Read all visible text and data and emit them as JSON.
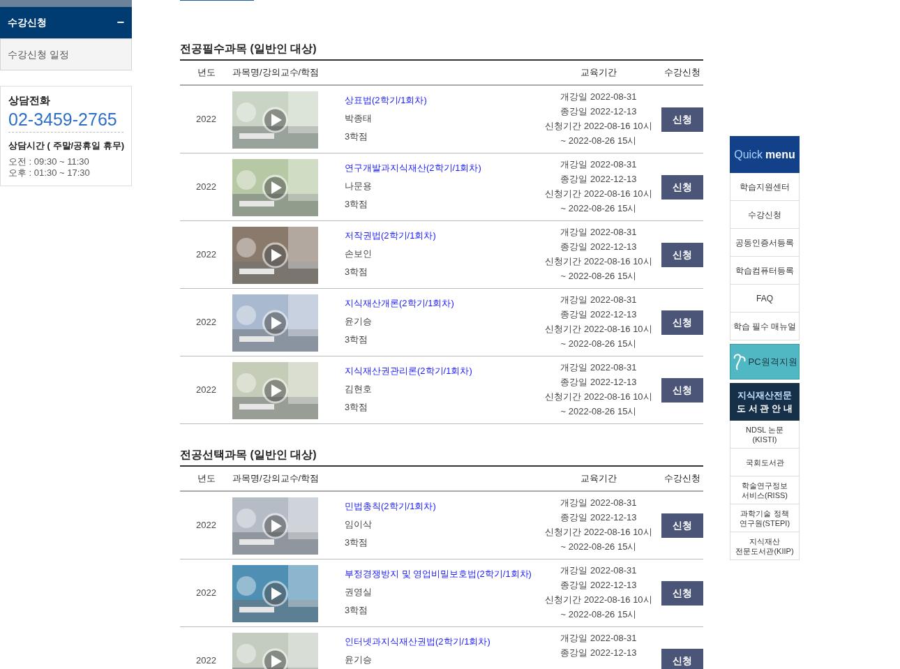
{
  "sidebar": {
    "menu_title": "수강신청",
    "toggle": "−",
    "items": [
      {
        "label": "수강신청 일정",
        "selected": false
      }
    ],
    "contact": {
      "title": "상담전화",
      "phone": "02-3459-2765",
      "hours_title": "상담시간 ( 주말/공휴일 휴무)",
      "hours": [
        "오전 : 09:30 ~ 11:30",
        "오후 : 01:30 ~ 17:30"
      ]
    }
  },
  "sections": [
    {
      "title": "전공필수과목 (일반인 대상)",
      "columns": [
        "년도",
        "과목명/강의교수/학점",
        "교육기간",
        "수강신청"
      ],
      "rows": [
        {
          "year": "2022",
          "course": "상표법(2학기/1회차)",
          "professor": "박종태",
          "credits": "3학점",
          "start": "개강일 2022-08-31",
          "end": "종강일 2022-12-13",
          "apply_start": "신청기간 2022-08-16 10시",
          "apply_end": "~ 2022-08-26 15시",
          "button": "신청"
        },
        {
          "year": "2022",
          "course": "연구개발과지식재산(2학기/1회차)",
          "professor": "나문용",
          "credits": "3학점",
          "start": "개강일 2022-08-31",
          "end": "종강일 2022-12-13",
          "apply_start": "신청기간 2022-08-16 10시",
          "apply_end": "~ 2022-08-26 15시",
          "button": "신청"
        },
        {
          "year": "2022",
          "course": "저작권법(2학기/1회차)",
          "professor": "손보인",
          "credits": "3학점",
          "start": "개강일 2022-08-31",
          "end": "종강일 2022-12-13",
          "apply_start": "신청기간 2022-08-16 10시",
          "apply_end": "~ 2022-08-26 15시",
          "button": "신청"
        },
        {
          "year": "2022",
          "course": "지식재산개론(2학기/1회차)",
          "professor": "윤기승",
          "credits": "3학점",
          "start": "개강일 2022-08-31",
          "end": "종강일 2022-12-13",
          "apply_start": "신청기간 2022-08-16 10시",
          "apply_end": "~ 2022-08-26 15시",
          "button": "신청"
        },
        {
          "year": "2022",
          "course": "지식재산권관리론(2학기/1회차)",
          "professor": "김현호",
          "credits": "3학점",
          "start": "개강일 2022-08-31",
          "end": "종강일 2022-12-13",
          "apply_start": "신청기간 2022-08-16 10시",
          "apply_end": "~ 2022-08-26 15시",
          "button": "신청"
        }
      ]
    },
    {
      "title": "전공선택과목 (일반인 대상)",
      "columns": [
        "년도",
        "과목명/강의교수/학점",
        "교육기간",
        "수강신청"
      ],
      "rows": [
        {
          "year": "2022",
          "course": "민법총칙(2학기/1회차)",
          "professor": "임이삭",
          "credits": "3학점",
          "start": "개강일 2022-08-31",
          "end": "종강일 2022-12-13",
          "apply_start": "신청기간 2022-08-16 10시",
          "apply_end": "~ 2022-08-26 15시",
          "button": "신청"
        },
        {
          "year": "2022",
          "course": "부정경쟁방지 및 영업비밀보호법(2학기/1회차)",
          "professor": "권영실",
          "credits": "3학점",
          "start": "개강일 2022-08-31",
          "end": "종강일 2022-12-13",
          "apply_start": "신청기간 2022-08-16 10시",
          "apply_end": "~ 2022-08-26 15시",
          "button": "신청"
        },
        {
          "year": "2022",
          "course": "인터넷과지식재산권법(2학기/1회차)",
          "professor": "윤기승",
          "start": "개강일 2022-08-31",
          "end": "종강일 2022-12-13",
          "button": "신청"
        }
      ]
    }
  ],
  "quick_menu": {
    "title_1": "Quick",
    "title_2": "menu",
    "items": [
      "학습지원센터",
      "수강신청",
      "공동인증서등록",
      "학습컴퓨터등록",
      "FAQ",
      "학습 필수 매뉴얼"
    ],
    "remote": "PC원격지원",
    "library_title_1": "지식재산전문",
    "library_title_2": "도 서 관 안 내",
    "libraries": [
      [
        "NDSL 논문",
        "(KISTI)"
      ],
      [
        "국회도서관"
      ],
      [
        "학술연구정보",
        "서비스(RISS)"
      ],
      [
        "과학기술 정책",
        "연구원(STEPI)"
      ],
      [
        "지식재산",
        "전문도서관(KIIP)"
      ]
    ]
  }
}
